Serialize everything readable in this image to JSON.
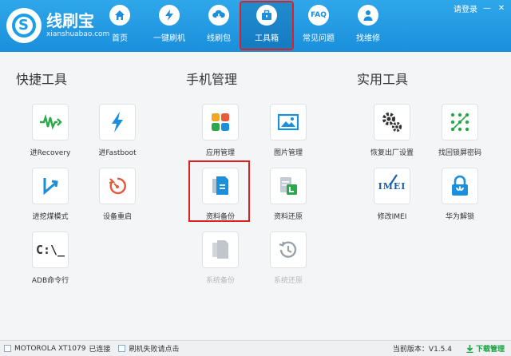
{
  "app": {
    "title": "线刷宝",
    "subtitle": "xianshuabao.com"
  },
  "top_right": {
    "login": "请登录",
    "minimize": "—",
    "close": "✕"
  },
  "nav": [
    {
      "label": "首页",
      "icon": "home-icon"
    },
    {
      "label": "一键刷机",
      "icon": "lightning-icon"
    },
    {
      "label": "线刷包",
      "icon": "download-cloud-icon"
    },
    {
      "label": "工具箱",
      "icon": "toolbox-icon",
      "active": true
    },
    {
      "label": "常见问题",
      "icon": "faq-icon",
      "icon_text": "FAQ"
    },
    {
      "label": "找维修",
      "icon": "technician-icon"
    }
  ],
  "sections": {
    "quick": "快捷工具",
    "phone": "手机管理",
    "utility": "实用工具"
  },
  "tools": {
    "recovery": {
      "label": "进Recovery"
    },
    "fastboot": {
      "label": "进Fastboot"
    },
    "edl": {
      "label": "进挖煤模式"
    },
    "reboot": {
      "label": "设备重启"
    },
    "adb": {
      "label": "ADB命令行",
      "icon_text": "C:\\_"
    },
    "apps": {
      "label": "应用管理"
    },
    "pictures": {
      "label": "图片管理"
    },
    "backup": {
      "label": "资料备份"
    },
    "restore": {
      "label": "资料还原"
    },
    "sys_backup": {
      "label": "系统备份"
    },
    "sys_restore": {
      "label": "系统还原"
    },
    "factory": {
      "label": "恢复出厂设置"
    },
    "unlock_pattern": {
      "label": "找回锁屏密码"
    },
    "imei": {
      "label": "修改IMEI",
      "icon_text": "IMEI"
    },
    "huawei": {
      "label": "华为解锁"
    }
  },
  "status": {
    "device": "MOTOROLA XT1079",
    "connected": "已连接",
    "fail_hint": "刷机失败请点击",
    "version_label": "当前版本：",
    "version": "V1.5.4",
    "download": "下载管理"
  },
  "colors": {
    "header": "#1a8fdc",
    "highlight": "#e02020",
    "green": "#1aa040",
    "blue": "#1a8fdc"
  }
}
